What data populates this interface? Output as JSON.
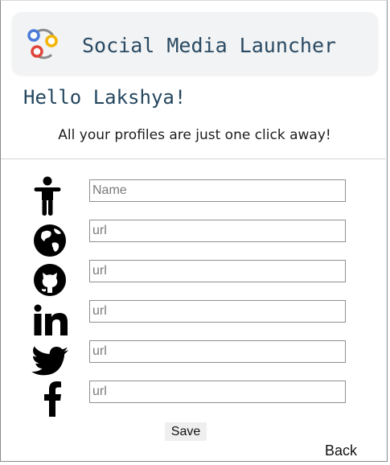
{
  "header": {
    "title": "Social Media Launcher",
    "logo_icon": "launcher-logo-icon"
  },
  "greeting": "Hello Lakshya!",
  "tagline": "All your profiles are just one click away!",
  "form": {
    "fields": [
      {
        "icon": "person-icon",
        "value": "",
        "placeholder": "Name"
      },
      {
        "icon": "globe-icon",
        "value": "",
        "placeholder": "url"
      },
      {
        "icon": "github-icon",
        "value": "",
        "placeholder": "url"
      },
      {
        "icon": "linkedin-icon",
        "value": "",
        "placeholder": "url"
      },
      {
        "icon": "twitter-icon",
        "value": "",
        "placeholder": "url"
      },
      {
        "icon": "facebook-icon",
        "value": "",
        "placeholder": "url"
      }
    ],
    "save_label": "Save"
  },
  "back_label": "Back",
  "colors": {
    "title": "#2a4a63",
    "header_bg": "#f1f3f4",
    "logo_blue": "#4a7bd9",
    "logo_red": "#e0453a",
    "logo_yellow": "#f4b400",
    "logo_grey": "#8a8a8a"
  }
}
